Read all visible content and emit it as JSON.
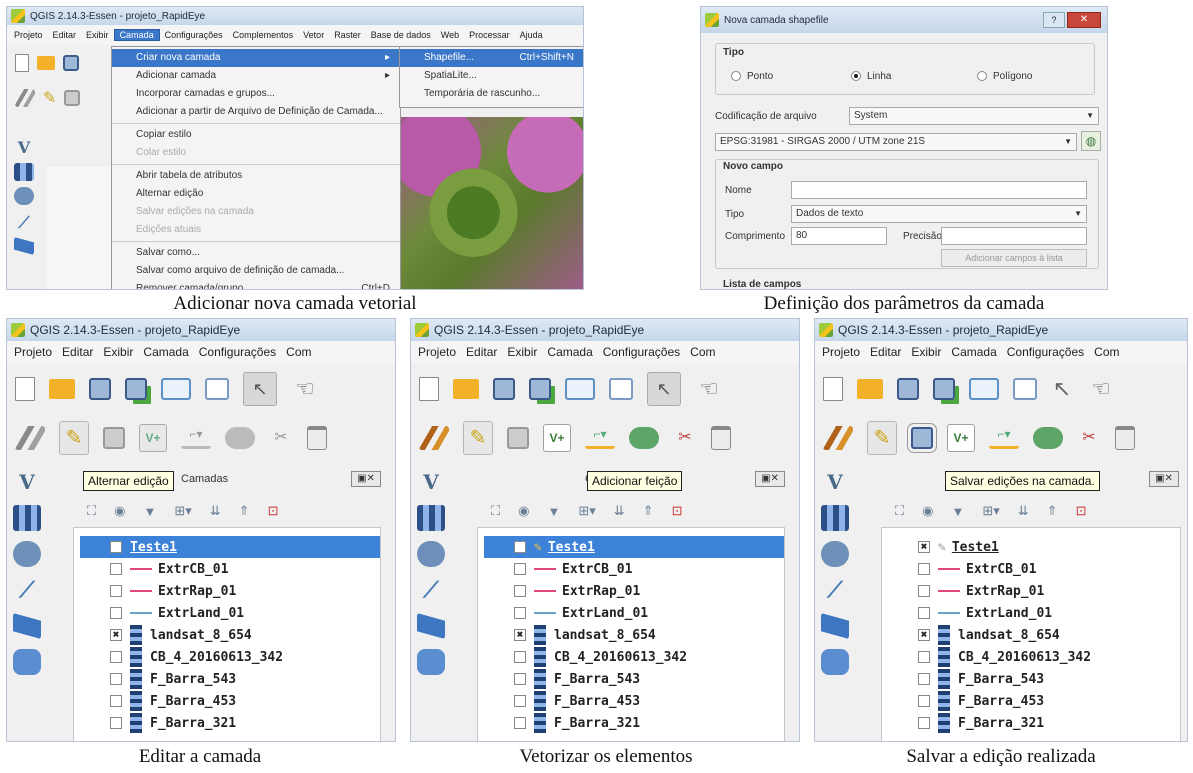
{
  "captions": {
    "top_left": "Adicionar nova camada vetorial",
    "top_right": "Definição dos parâmetros da camada",
    "bottom_left": "Editar a camada",
    "bottom_mid": "Vetorizar os elementos",
    "bottom_right": "Salvar a edição realizada"
  },
  "app_title": "QGIS 2.14.3-Essen - projeto_RapidEye",
  "menu_short": [
    "Projeto",
    "Editar",
    "Exibir",
    "Camada",
    "Configurações",
    "Com"
  ],
  "menu_full": [
    "Projeto",
    "Editar",
    "Exibir",
    "Camada",
    "Configurações",
    "Complementos",
    "Vetor",
    "Raster",
    "Base de dados",
    "Web",
    "Processar",
    "Ajuda"
  ],
  "camada_menu": {
    "items": [
      {
        "label": "Criar nova camada",
        "shortcut": "",
        "state": "highlight"
      },
      {
        "label": "Adicionar camada",
        "shortcut": "",
        "state": "normal"
      },
      {
        "label": "Incorporar camadas e grupos...",
        "shortcut": "",
        "state": "normal"
      },
      {
        "label": "Adicionar a partir de Arquivo de Definição de Camada...",
        "shortcut": "",
        "state": "normal"
      },
      {
        "label": "Copiar estilo",
        "shortcut": "",
        "state": "normal"
      },
      {
        "label": "Colar estilo",
        "shortcut": "",
        "state": "disabled"
      },
      {
        "label": "Abrir tabela de atributos",
        "shortcut": "",
        "state": "normal"
      },
      {
        "label": "Alternar edição",
        "shortcut": "",
        "state": "normal"
      },
      {
        "label": "Salvar edições na camada",
        "shortcut": "",
        "state": "disabled"
      },
      {
        "label": "Edições atuais",
        "shortcut": "",
        "state": "disabled"
      },
      {
        "label": "Salvar como...",
        "shortcut": "",
        "state": "normal"
      },
      {
        "label": "Salvar como arquivo de definição de camada...",
        "shortcut": "",
        "state": "normal"
      },
      {
        "label": "Remover camada/grupo",
        "shortcut": "Ctrl+D",
        "state": "normal"
      }
    ],
    "submenu": [
      {
        "label": "Shapefile...",
        "shortcut": "Ctrl+Shift+N"
      },
      {
        "label": "SpatiaLite...",
        "shortcut": ""
      },
      {
        "label": "Temporária de rascunho...",
        "shortcut": ""
      }
    ]
  },
  "dialog": {
    "title": "Nova camada shapefile",
    "tipo_label": "Tipo",
    "tipo_options": [
      "Ponto",
      "Linha",
      "Polígono"
    ],
    "tipo_selected": "Linha",
    "encoding_label": "Codificação de arquivo",
    "encoding_value": "System",
    "crs_value": "EPSG:31981 - SIRGAS 2000 / UTM zone 21S",
    "novo_campo": "Novo campo",
    "nome_label": "Nome",
    "tipo_campo_label": "Tipo",
    "tipo_campo_value": "Dados de texto",
    "comprimento_label": "Comprimento",
    "comprimento_value": "80",
    "precisao_label": "Precisão",
    "add_button": "Adicionar campos à lista",
    "lista_label": "Lista de campos"
  },
  "layers": [
    {
      "name": "Teste1",
      "kind": "none",
      "color": ""
    },
    {
      "name": "ExtrCB_01",
      "kind": "line",
      "color": "#e0457b"
    },
    {
      "name": "ExtrRap_01",
      "kind": "line",
      "color": "#e0457b"
    },
    {
      "name": "ExtrLand_01",
      "kind": "line",
      "color": "#6aa3c8"
    },
    {
      "name": "landsat_8_654",
      "kind": "raster",
      "color": ""
    },
    {
      "name": "CB_4_20160613_342",
      "kind": "raster",
      "color": ""
    },
    {
      "name": "F_Barra_543",
      "kind": "raster",
      "color": ""
    },
    {
      "name": "F_Barra_453",
      "kind": "raster",
      "color": ""
    },
    {
      "name": "F_Barra_321",
      "kind": "raster",
      "color": ""
    }
  ],
  "layers_panel_label": "Camadas",
  "tooltips": {
    "bottom_left": "Alternar edição",
    "bottom_mid": "Adicionar feição",
    "bottom_right": "Salvar edições na camada."
  },
  "colors": {
    "selection": "#3c82d9",
    "accent": "#3b77c9"
  }
}
